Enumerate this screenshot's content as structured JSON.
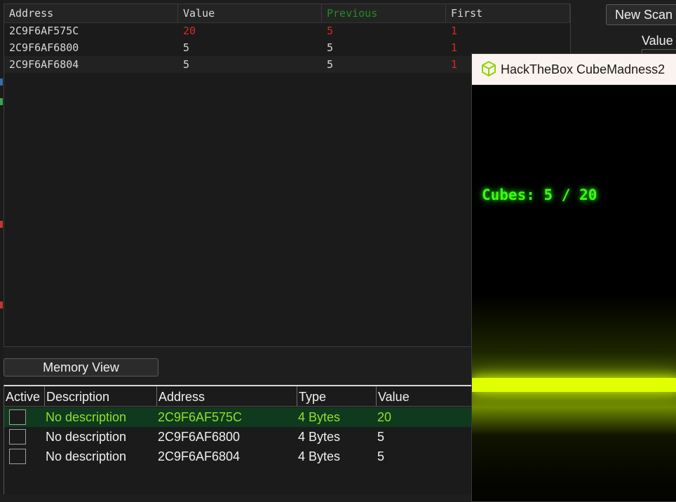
{
  "scan_results": {
    "headers": [
      "Address",
      "Value",
      "Previous",
      "First"
    ],
    "rows": [
      {
        "address": "2C9F6AF575C",
        "value": "20",
        "previous": "5",
        "first": "1"
      },
      {
        "address": "2C9F6AF6800",
        "value": "5",
        "previous": "5",
        "first": "1"
      },
      {
        "address": "2C9F6AF6804",
        "value": "5",
        "previous": "5",
        "first": "1"
      }
    ]
  },
  "toolbar": {
    "new_scan_label": "New Scan",
    "value_label": "Value"
  },
  "memory_view_label": "Memory View",
  "address_list": {
    "headers": [
      "Active",
      "Description",
      "Address",
      "Type",
      "Value"
    ],
    "rows": [
      {
        "description": "No description",
        "address": "2C9F6AF575C",
        "type": "4 Bytes",
        "value": "20",
        "selected": true
      },
      {
        "description": "No description",
        "address": "2C9F6AF6800",
        "type": "4 Bytes",
        "value": "5",
        "selected": false
      },
      {
        "description": "No description",
        "address": "2C9F6AF6804",
        "type": "4 Bytes",
        "value": "5",
        "selected": false
      }
    ]
  },
  "game": {
    "window_title": "HackTheBox CubeMadness2",
    "counter_text": "Cubes: 5 / 20",
    "icon": "cube-icon"
  },
  "colors": {
    "background": "#1e1e1e",
    "changed_value": "#d42a2a",
    "previous_header": "#1e8f1e",
    "selected_row_text": "#8fe02a",
    "game_counter": "#39ff14",
    "game_floor": "#e0ff00"
  }
}
